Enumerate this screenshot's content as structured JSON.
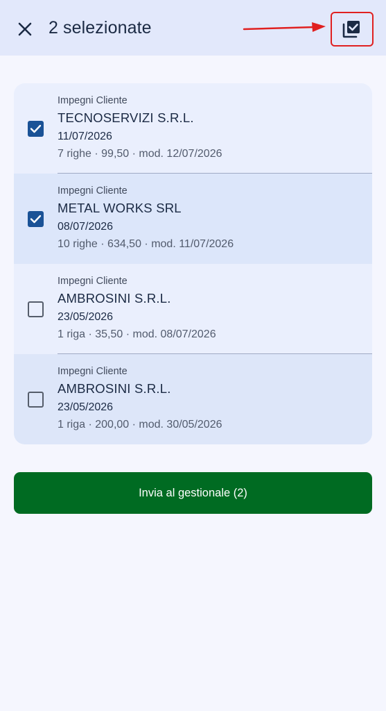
{
  "header": {
    "title": "2 selezionate",
    "close_icon": "close-icon",
    "select_all_icon": "select-all-icon"
  },
  "items": [
    {
      "category": "Impegni Cliente",
      "name": "TECNOSERVIZI S.R.L.",
      "date": "11/07/2026",
      "meta": "7 righe · 99,50 · mod. 12/07/2026",
      "checked": true
    },
    {
      "category": "Impegni Cliente",
      "name": "METAL WORKS SRL",
      "date": "08/07/2026",
      "meta": "10 righe · 634,50 · mod. 11/07/2026",
      "checked": true
    },
    {
      "category": "Impegni Cliente",
      "name": "AMBROSINI S.R.L.",
      "date": "23/05/2026",
      "meta": "1 riga · 35,50 · mod. 08/07/2026",
      "checked": false
    },
    {
      "category": "Impegni Cliente",
      "name": "AMBROSINI S.R.L.",
      "date": "23/05/2026",
      "meta": "1 riga · 200,00 · mod. 30/05/2026",
      "checked": false
    }
  ],
  "send_button": {
    "label": "Invia al gestionale (2)"
  },
  "colors": {
    "accent": "#1a5296",
    "send_button": "#006b22",
    "highlight": "#e02020"
  }
}
